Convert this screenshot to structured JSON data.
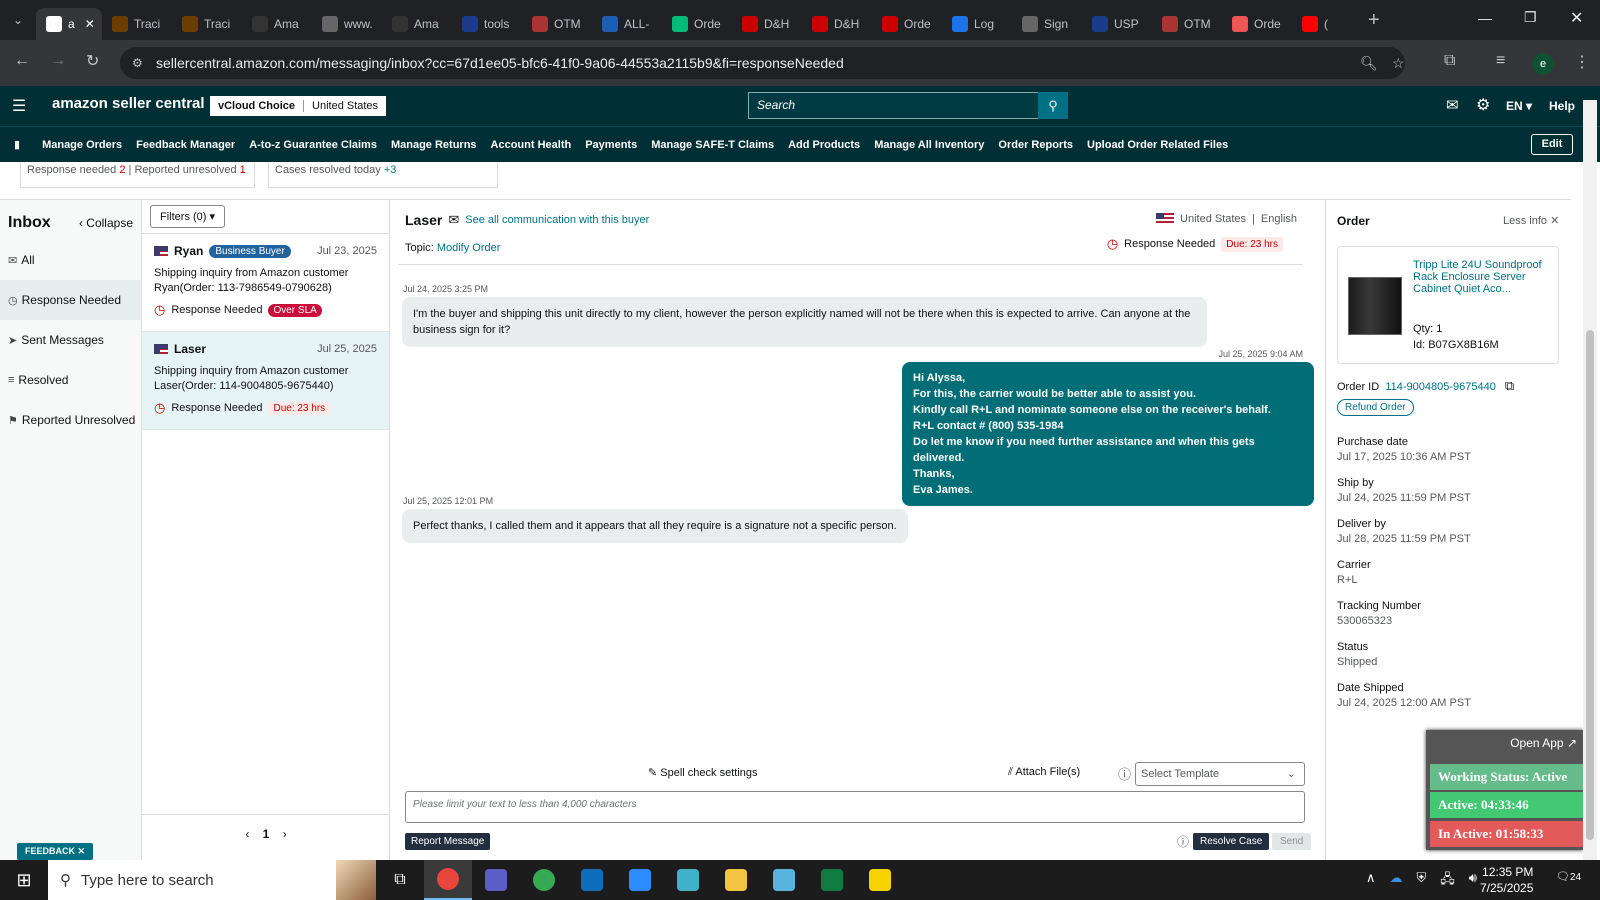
{
  "browser": {
    "tabs": [
      {
        "label": "a",
        "favicon": "amazon-icon",
        "color": "#ffffff"
      },
      {
        "label": "Traci",
        "favicon": "ups-icon",
        "color": "#6b3e00"
      },
      {
        "label": "Traci",
        "favicon": "ups-icon",
        "color": "#6b3e00"
      },
      {
        "label": "Ama",
        "favicon": "amazon-icon",
        "color": "#333"
      },
      {
        "label": "www.",
        "favicon": "globe-icon",
        "color": "#666"
      },
      {
        "label": "Ama",
        "favicon": "amazon-icon",
        "color": "#333"
      },
      {
        "label": "tools",
        "favicon": "flag-icon",
        "color": "#1a3b8a"
      },
      {
        "label": "OTM",
        "favicon": "otm-icon",
        "color": "#a33"
      },
      {
        "label": "ALL-",
        "favicon": "17-icon",
        "color": "#1a5fb4"
      },
      {
        "label": "Orde",
        "favicon": "ec-icon",
        "color": "#0b7"
      },
      {
        "label": "D&H",
        "favicon": "dh-icon",
        "color": "#c00"
      },
      {
        "label": "D&H",
        "favicon": "dh-icon",
        "color": "#c00"
      },
      {
        "label": "Orde",
        "favicon": "dh-icon",
        "color": "#c00"
      },
      {
        "label": "Log",
        "favicon": "g-icon",
        "color": "#1a73e8"
      },
      {
        "label": "Sign",
        "favicon": "globe-icon",
        "color": "#666"
      },
      {
        "label": "USP",
        "favicon": "flag-icon",
        "color": "#1a3b8a"
      },
      {
        "label": "OTM",
        "favicon": "otm-icon",
        "color": "#a33"
      },
      {
        "label": "Orde",
        "favicon": "orde-icon",
        "color": "#e55"
      },
      {
        "label": "(",
        "favicon": "youtube-icon",
        "color": "#f00"
      }
    ],
    "url": "sellercentral.amazon.com/messaging/inbox?cc=67d1ee05-bfc6-41f0-9a06-44553a2115b9&fi=responseNeeded",
    "profile_initial": "e"
  },
  "header": {
    "brand": "amazon seller central",
    "store": "vCloud Choice",
    "marketplace": "United States",
    "search_placeholder": "Search",
    "language": "EN",
    "help": "Help"
  },
  "nav": {
    "items": [
      "Manage Orders",
      "Feedback Manager",
      "A-to-z Guarantee Claims",
      "Manage Returns",
      "Account Health",
      "Payments",
      "Manage SAFE-T Claims",
      "Add Products",
      "Manage All Inventory",
      "Order Reports",
      "Upload Order Related Files"
    ],
    "edit": "Edit"
  },
  "summary": {
    "response_needed_label": "Response needed",
    "response_needed_count": "2",
    "reported_unresolved_label": "Reported unresolved",
    "reported_unresolved_count": "1",
    "resolved_today_label": "Cases resolved today",
    "resolved_today_count": "+3"
  },
  "inbox": {
    "title": "Inbox",
    "collapse": "Collapse",
    "filters": "Filters (0)",
    "folders": [
      "All",
      "Response Needed",
      "Sent Messages",
      "Resolved",
      "Reported Unresolved"
    ],
    "page": "1",
    "feedback": "FEEDBACK"
  },
  "threads": [
    {
      "name": "Ryan",
      "badge": "Business Buyer",
      "date": "Jul 23, 2025",
      "subject": "Shipping inquiry from Amazon customer Ryan(Order: 113-7986549-0790628)",
      "status": "Response Needed",
      "sla": "Over SLA"
    },
    {
      "name": "Laser",
      "badge": "",
      "date": "Jul 25, 2025",
      "subject": "Shipping inquiry from Amazon customer Laser(Order: 114-9004805-9675440)",
      "status": "Response Needed",
      "sla": "Due: 23 hrs"
    }
  ],
  "conversation": {
    "buyer": "Laser",
    "see_all": "See all communication with this buyer",
    "country": "United States",
    "language": "English",
    "topic_label": "Topic:",
    "topic": "Modify Order",
    "status": "Response Needed",
    "due": "Due: 23 hrs",
    "messages": [
      {
        "ts": "Jul 24, 2025 3:25 PM",
        "text": "I'm the buyer and shipping this unit directly to my client, however the person explicitly named will not be there when this is expected to arrive. Can anyone at the business sign for it?"
      },
      {
        "ts": "Jul 25, 2025 9:04 AM",
        "lines": [
          "Hi Alyssa,",
          "For this, the carrier would be better able to assist you.",
          "Kindly call R+L and nominate someone else on the receiver's behalf.",
          "R+L contact # (800) 535-1984",
          "Do let me know if you need further assistance and when this gets delivered.",
          "Thanks,",
          "Eva James."
        ]
      },
      {
        "ts": "Jul 25, 2025 12:01 PM",
        "text": "Perfect thanks, I called them and it appears that all they require is a signature not a specific person."
      }
    ],
    "spell_check": "Spell check settings",
    "attach": "Attach File(s)",
    "template_placeholder": "Select Template",
    "reply_placeholder": "Please limit your text to less than 4,000 characters",
    "report": "Report Message",
    "resolve": "Resolve Case",
    "send": "Send"
  },
  "order": {
    "title": "Order",
    "less_info": "Less info",
    "product": "Tripp Lite 24U Soundproof Rack Enclosure Server Cabinet Quiet Aco...",
    "qty": "Qty: 1",
    "id": "Id: B07GX8B16M",
    "order_id_label": "Order ID",
    "order_id": "114-9004805-9675440",
    "refund": "Refund Order",
    "fields": [
      {
        "label": "Purchase date",
        "value": "Jul 17, 2025 10:36 AM PST"
      },
      {
        "label": "Ship by",
        "value": "Jul 24, 2025 11:59 PM PST"
      },
      {
        "label": "Deliver by",
        "value": "Jul 28, 2025 11:59 PM PST"
      },
      {
        "label": "Carrier",
        "value": "R+L"
      },
      {
        "label": "Tracking Number",
        "value": "530065323"
      },
      {
        "label": "Status",
        "value": "Shipped"
      },
      {
        "label": "Date Shipped",
        "value": "Jul 24, 2025 12:00 AM PST"
      }
    ]
  },
  "widget": {
    "open_app": "Open App",
    "working": "Working Status: Active",
    "active": "Active: 04:33:46",
    "inactive": "In Active: 01:58:33"
  },
  "taskbar": {
    "search_placeholder": "Type here to search",
    "time": "12:35 PM",
    "date": "7/25/2025",
    "notifications": "24"
  }
}
